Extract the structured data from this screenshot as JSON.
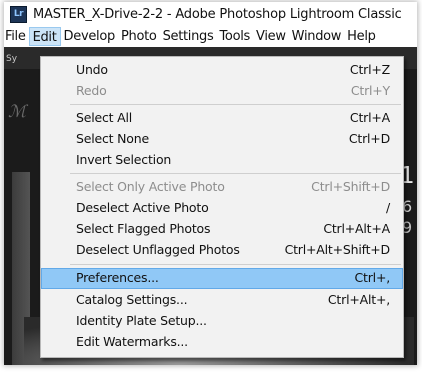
{
  "window": {
    "title": "MASTER_X-Drive-2-2 - Adobe Photoshop Lightroom Classic",
    "app_icon_text": "Lr"
  },
  "menubar": [
    {
      "label": "File"
    },
    {
      "label": "Edit",
      "active": true
    },
    {
      "label": "Develop"
    },
    {
      "label": "Photo"
    },
    {
      "label": "Settings"
    },
    {
      "label": "Tools"
    },
    {
      "label": "View"
    },
    {
      "label": "Window"
    },
    {
      "label": "Help"
    }
  ],
  "background": {
    "sys_label": "Sy",
    "script_glyph": "ℳ",
    "big_number": "1",
    "small_number_1": "6",
    "small_number_2": "9"
  },
  "edit_menu": {
    "items": [
      {
        "label": "Undo",
        "shortcut": "Ctrl+Z",
        "disabled": false
      },
      {
        "label": "Redo",
        "shortcut": "Ctrl+Y",
        "disabled": true
      },
      {
        "label": "Select All",
        "shortcut": "Ctrl+A",
        "disabled": false
      },
      {
        "label": "Select None",
        "shortcut": "Ctrl+D",
        "disabled": false
      },
      {
        "label": "Invert Selection",
        "shortcut": "",
        "disabled": false
      },
      {
        "label": "Select Only Active Photo",
        "shortcut": "Ctrl+Shift+D",
        "disabled": true
      },
      {
        "label": "Deselect Active Photo",
        "shortcut": "/",
        "disabled": false
      },
      {
        "label": "Select Flagged Photos",
        "shortcut": "Ctrl+Alt+A",
        "disabled": false
      },
      {
        "label": "Deselect Unflagged Photos",
        "shortcut": "Ctrl+Alt+Shift+D",
        "disabled": false
      },
      {
        "label": "Preferences...",
        "shortcut": "Ctrl+,",
        "disabled": false,
        "highlighted": true
      },
      {
        "label": "Catalog Settings...",
        "shortcut": "Ctrl+Alt+,",
        "disabled": false
      },
      {
        "label": "Identity Plate Setup...",
        "shortcut": "",
        "disabled": false
      },
      {
        "label": "Edit Watermarks...",
        "shortcut": "",
        "disabled": false
      }
    ]
  },
  "colors": {
    "menu_background": "#f2f2f2",
    "highlight": "#90c8f6",
    "highlight_border": "#62a9e8",
    "active_menu": "#cce4f7",
    "disabled_text": "#8d8d8d",
    "content_background": "#1b1b1b"
  }
}
